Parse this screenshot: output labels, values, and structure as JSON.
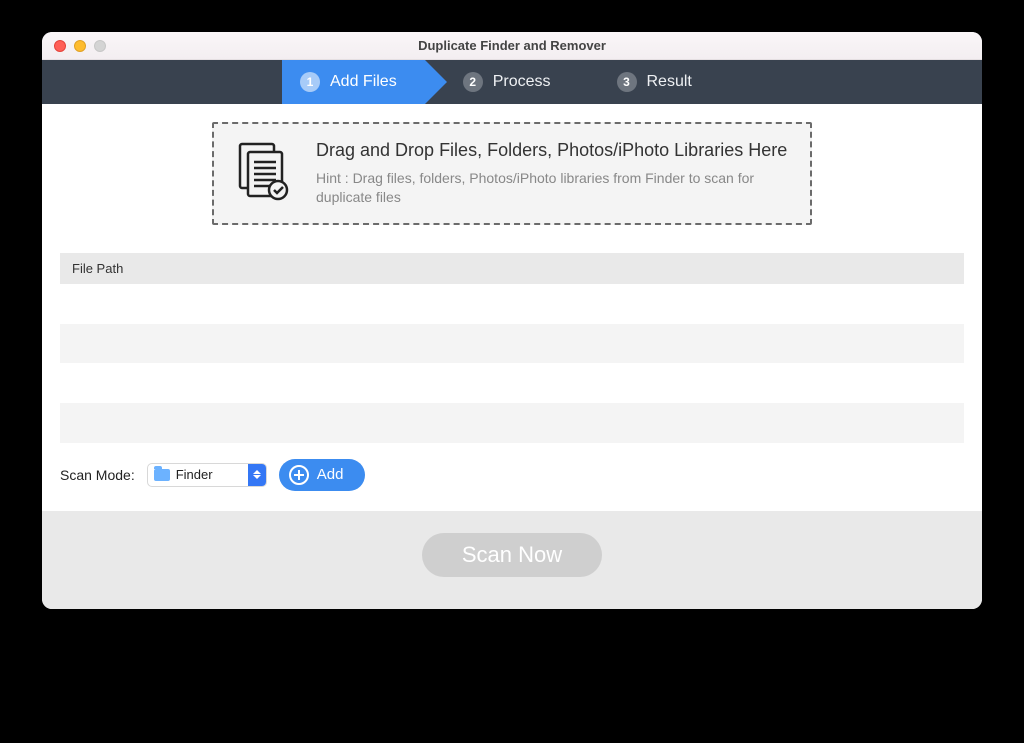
{
  "window": {
    "title": "Duplicate Finder and Remover"
  },
  "steps": [
    {
      "num": "1",
      "label": "Add Files",
      "active": true
    },
    {
      "num": "2",
      "label": "Process",
      "active": false
    },
    {
      "num": "3",
      "label": "Result",
      "active": false
    }
  ],
  "dropzone": {
    "heading": "Drag and Drop Files, Folders, Photos/iPhoto Libraries Here",
    "hint": "Hint : Drag files, folders, Photos/iPhoto libraries from Finder to scan for duplicate files"
  },
  "table": {
    "header": "File Path",
    "rows": [
      "",
      "",
      "",
      ""
    ]
  },
  "controls": {
    "scan_mode_label": "Scan Mode:",
    "scan_mode_value": "Finder",
    "add_label": "Add"
  },
  "footer": {
    "scan_label": "Scan Now"
  }
}
